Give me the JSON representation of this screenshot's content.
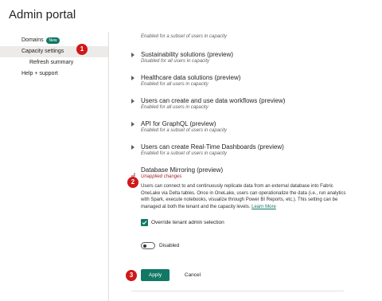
{
  "page": {
    "title": "Admin portal"
  },
  "sidebar": {
    "items": [
      {
        "label": "Domains",
        "badge": "New"
      },
      {
        "label": "Capacity settings"
      },
      {
        "label": "Refresh summary"
      },
      {
        "label": "Help + support"
      }
    ]
  },
  "callouts": [
    "1",
    "2",
    "3"
  ],
  "settings": {
    "top_status": "Enabled for a subset of users in capacity",
    "items": [
      {
        "title": "Sustainability solutions (preview)",
        "status": "Disabled for all users in capacity"
      },
      {
        "title": "Healthcare data solutions (preview)",
        "status": "Enabled for all users in capacity"
      },
      {
        "title": "Users can create and use data workflows (preview)",
        "status": "Enabled for all users in capacity"
      },
      {
        "title": "API for GraphQL (preview)",
        "status": "Enabled for a subset of users in capacity"
      },
      {
        "title": "Users can create Real-Time Dashboards (preview)",
        "status": "Enabled for a subset of users in capacity"
      }
    ],
    "expanded": {
      "title": "Database Mirroring (preview)",
      "status": "Unapplied changes",
      "description": "Users can connect to and continuously replicate data from an external database into Fabric OneLake via Delta tables. Once in OneLake, users can operationalize the data (i.e., run analytics with Spark, execute notebooks, visualize through Power BI Reports, etc.). This setting can be managed at both the tenant and the capacity levels.",
      "learn_more": "Learn More",
      "checkbox_label": "Override tenant admin selection",
      "checkbox_checked": true,
      "toggle_label": "Disabled",
      "toggle_on": false
    }
  },
  "actions": {
    "apply": "Apply",
    "cancel": "Cancel"
  },
  "colors": {
    "accent": "#117865",
    "callout": "#d01818",
    "unapplied": "#a4262c"
  }
}
